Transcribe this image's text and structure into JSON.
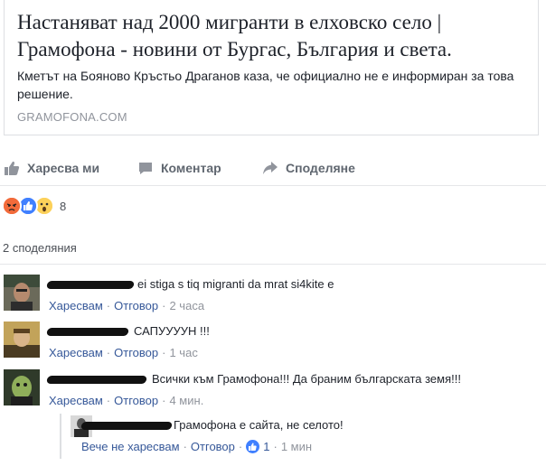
{
  "link_card": {
    "title": "Настаняват над 2000 мигранти в елховско село | Грамофона - новини от Бургас, България и света.",
    "description": "Кметът на Бояново Кръстьо Драганов каза, че официално не е информиран за това решение.",
    "domain": "GRAMOFONA.COM"
  },
  "actions": {
    "like": "Харесва ми",
    "comment": "Коментар",
    "share": "Споделяне"
  },
  "reactions": {
    "icons": [
      "angry-reaction-icon",
      "like-reaction-icon",
      "wow-reaction-icon"
    ],
    "count": "8"
  },
  "shares": "2 споделяния",
  "comments": [
    {
      "text": "ei stiga s tiq migranti da mrat si4kite e",
      "like": "Харесвам",
      "reply": "Отговор",
      "time": "2 часа"
    },
    {
      "text": "САПУУУУН !!!",
      "like": "Харесвам",
      "reply": "Отговор",
      "time": "1 час"
    },
    {
      "text": "Всички към Грамофона!!! Да браним българската земя!!!",
      "like": "Харесвам",
      "reply": "Отговор",
      "time": "4 мин."
    }
  ],
  "reply": {
    "text": "Грамофона е сайта, не селото!",
    "unlike": "Вече не харесвам",
    "reply": "Отговор",
    "likes": "1",
    "time": "1 мин"
  },
  "colors": {
    "link_blue": "#365899",
    "meta_gray": "#90949c",
    "like_blue": "#4080ff"
  }
}
